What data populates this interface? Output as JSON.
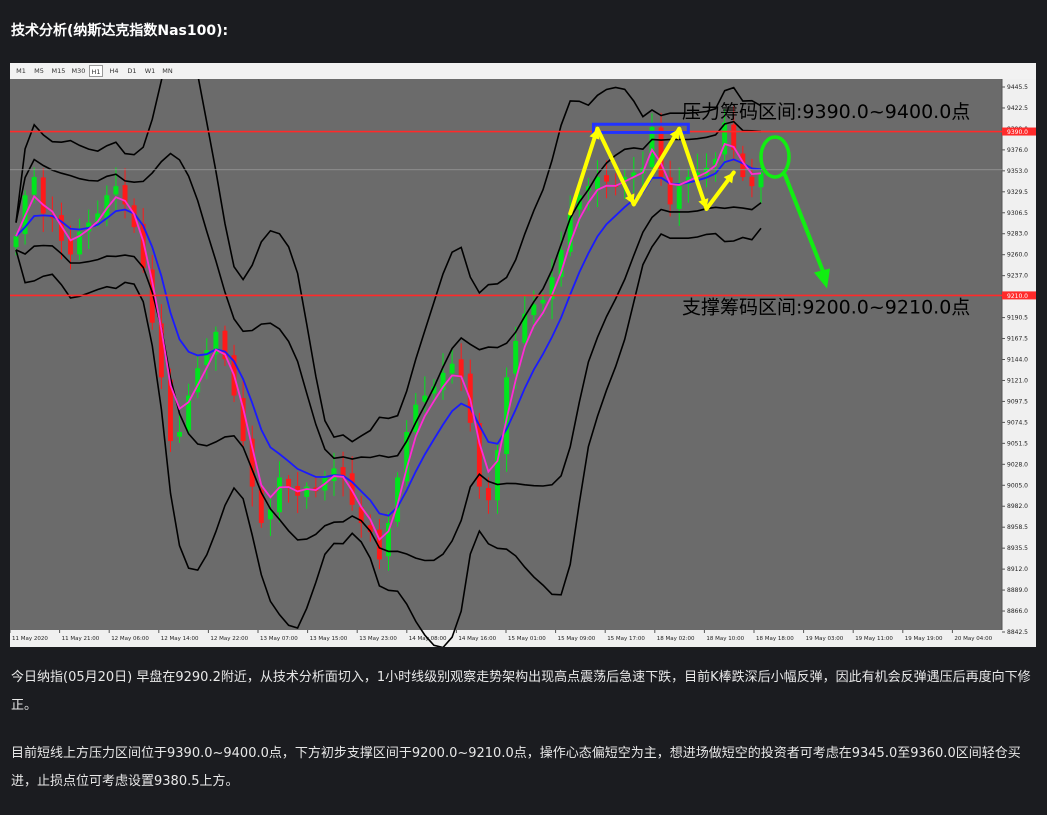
{
  "page": {
    "title": "技术分析(纳斯达克指数Nas100):"
  },
  "toolbar": {
    "timeframes": [
      "M1",
      "M5",
      "M15",
      "M30",
      "H1",
      "H4",
      "D1",
      "W1",
      "MN"
    ],
    "active": "H1"
  },
  "chart_data": {
    "type": "candlestick",
    "ylim": [
      8842.5,
      9445.5
    ],
    "y_ticks": [
      "9445.5",
      "9422.5",
      "9399.0",
      "9376.0",
      "9353.0",
      "9329.5",
      "9306.5",
      "9283.0",
      "9260.0",
      "9237.0",
      "9213.5",
      "9190.5",
      "9167.5",
      "9144.0",
      "9121.0",
      "9097.5",
      "9074.5",
      "9051.5",
      "9028.0",
      "9005.0",
      "8982.0",
      "8958.5",
      "8935.5",
      "8912.0",
      "8889.0",
      "8866.0",
      "8842.5"
    ],
    "x_ticks": [
      "11 May 2020",
      "11 May 21:00",
      "12 May 06:00",
      "12 May 14:00",
      "12 May 22:00",
      "13 May 07:00",
      "13 May 15:00",
      "13 May 23:00",
      "14 May 08:00",
      "14 May 16:00",
      "15 May 01:00",
      "15 May 09:00",
      "15 May 17:00",
      "18 May 02:00",
      "18 May 10:00",
      "18 May 18:00",
      "19 May 03:00",
      "19 May 11:00",
      "19 May 19:00",
      "20 May 04:00"
    ],
    "closes": [
      9275,
      9320,
      9340,
      9300,
      9295,
      9270,
      9255,
      9280,
      9290,
      9300,
      9320,
      9330,
      9310,
      9285,
      9240,
      9180,
      9120,
      9050,
      9060,
      9100,
      9130,
      9150,
      9170,
      9140,
      9100,
      9050,
      9000,
      8960,
      8975,
      9010,
      9000,
      8990,
      9000,
      8995,
      9010,
      9020,
      9010,
      8980,
      8960,
      8950,
      8920,
      8960,
      9010,
      9060,
      9090,
      9100,
      9110,
      9125,
      9135,
      9120,
      9070,
      9000,
      8985,
      9040,
      9120,
      9160,
      9190,
      9200,
      9205,
      9230,
      9260,
      9300,
      9320,
      9330,
      9340,
      9335,
      9330,
      9340,
      9345,
      9350,
      9395,
      9340,
      9310,
      9330,
      9340,
      9345,
      9350,
      9360,
      9400,
      9370,
      9340,
      9330,
      9345
    ],
    "levels": [
      {
        "label": "9390.0",
        "value": 9390.0,
        "color": "#ff2a2a"
      },
      {
        "label": "9210.0",
        "value": 9210.0,
        "color": "#ff2a2a"
      }
    ],
    "current_price": 9348.0,
    "annotations": {
      "resistance": "压力筹码区间:9390.0~9400.0点",
      "support": "支撑筹码区间:9200.0~9210.0点"
    },
    "colors": {
      "background": "#6b6b6b",
      "bull": "#00e51d",
      "bear": "#ff1a1a",
      "ma_fast": "#ff2bd4",
      "ma_slow": "#1a1aff",
      "band": "#000000",
      "arrow_zigzag": "#ffff00",
      "arrow_down": "#11ee11",
      "box": "#2233ff"
    }
  },
  "body": {
    "paragraph1": "今日纳指(05月20日) 早盘在9290.2附近，从技术分析面切入，1小时线级别观察走势架构出现高点震荡后急速下跌，目前K棒跌深后小幅反弹，因此有机会反弹遇压后再度向下修正。",
    "paragraph2": "目前短线上方压力区间位于9390.0~9400.0点，下方初步支撑区间于9200.0~9210.0点，操作心态偏短空为主，想进场做短空的投资者可考虑在9345.0至9360.0区间轻仓买进，止损点位可考虑设置9380.5上方。"
  }
}
